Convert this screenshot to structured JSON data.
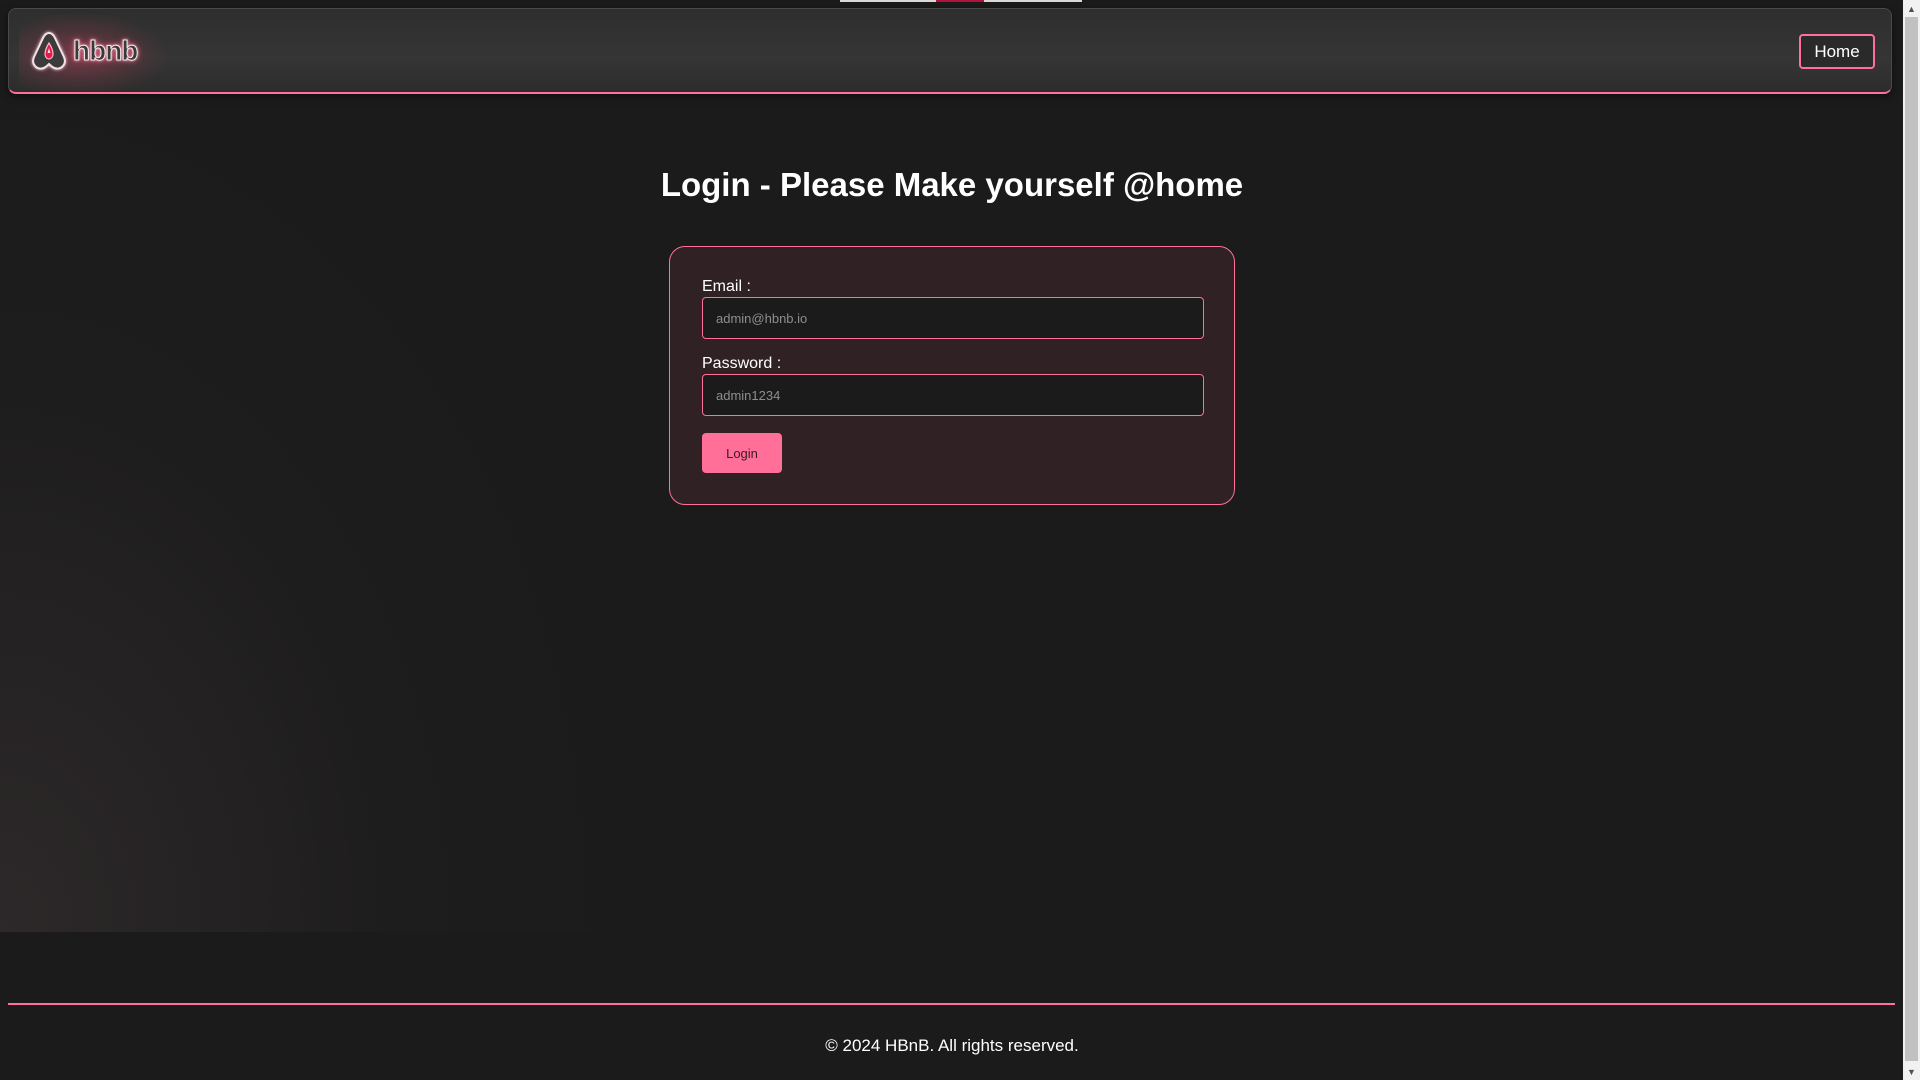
{
  "header": {
    "logo_text": "hbnb",
    "home_label": "Home"
  },
  "main": {
    "title": "Login - Please Make yourself @home",
    "form": {
      "email_label": "Email :",
      "email_placeholder": "admin@hbnb.io",
      "password_label": "Password :",
      "password_placeholder": "admin1234",
      "login_label": "Login"
    }
  },
  "footer": {
    "copyright": "© 2024 HBnB. All rights reserved."
  },
  "colors": {
    "accent": "#ff6f9a",
    "button": "#ff6f97",
    "background": "#1b1b1b",
    "card": "#2f2124"
  },
  "icons": {
    "logo": "airbnb-logo-icon",
    "scroll_up": "arrow-up-icon",
    "scroll_down": "arrow-down-icon"
  }
}
